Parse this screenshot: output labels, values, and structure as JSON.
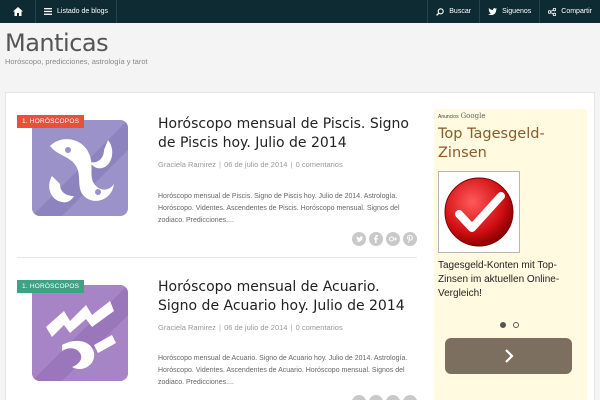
{
  "topbar": {
    "home_icon": "home-icon",
    "blogs_label": "Listado de blogs",
    "buscar_label": "Buscar",
    "siguenos_label": "Siguenos",
    "compartir_label": "Compartir"
  },
  "site": {
    "title": "Manticas",
    "description": "Horóscopo, predicciones, astrología y tarot"
  },
  "posts": [
    {
      "badge": "1. HORÓSCOPOS",
      "badge_color": "#e8503a",
      "thumb_color": "#9b92c9",
      "title": "Horóscopo mensual de Piscis. Signo de Piscis hoy. Julio de 2014",
      "author": "Graciela Ramirez",
      "date": "06 de julio de 2014",
      "comments": "0 comentarios",
      "excerpt": "Horóscopo mensual de Piscis. Signo de Piscis hoy. Julio de 2014. Astrología. Horóscopo. Videntes. Ascendentes de Piscis. Horóscopo mensual. Signos del zodiaco. Predicciones...."
    },
    {
      "badge": "1. HORÓSCOPOS",
      "badge_color": "#3ea383",
      "thumb_color": "#a784c6",
      "title": "Horóscopo mensual de Acuario. Signo de Acuario hoy. Julio de 2014",
      "author": "Graciela Ramirez",
      "date": "06 de julio de 2014",
      "comments": "0 comentarios",
      "excerpt": "Horóscopo mensual de Acuario. Signo de Acuario hoy. Julio de 2014. Astrología. Horóscopo. Videntes. Ascendentes de Acuario. Horóscopo mensual. Signos del zodiaco. Predicciones...."
    }
  ],
  "ad": {
    "label": "Anuncios",
    "label_brand": "Google",
    "title": "Top Tagesgeld-Zinsen",
    "text": "Tagesgeld-Konten mit Top-Zinsen im aktuellen Online-Vergleich!",
    "slide_count": 2,
    "active_slide": 1
  },
  "share_icons": [
    "twitter-icon",
    "facebook-icon",
    "google-plus-icon",
    "pinterest-icon"
  ]
}
